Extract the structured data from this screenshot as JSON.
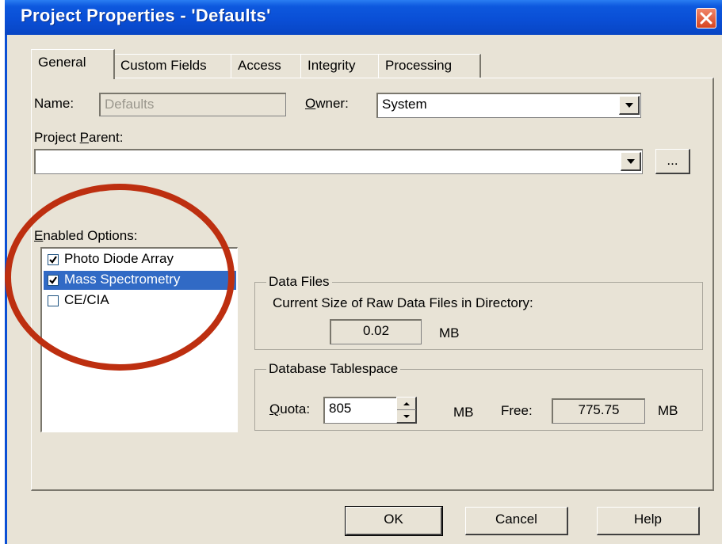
{
  "window": {
    "title": "Project Properties - 'Defaults'"
  },
  "tabs": [
    {
      "label": "General"
    },
    {
      "label": "Custom Fields"
    },
    {
      "label": "Access"
    },
    {
      "label": "Integrity"
    },
    {
      "label": "Processing"
    }
  ],
  "general": {
    "name_label": "Name:",
    "name_value": "Defaults",
    "owner_label_first": "O",
    "owner_label_rest": "wner:",
    "owner_value": "System",
    "parent_label_pre": "Project ",
    "parent_label_u": "P",
    "parent_label_post": "arent:",
    "parent_value": "",
    "browse_label": "...",
    "enabled_label_u": "E",
    "enabled_label_rest": "nabled Options:",
    "options": [
      {
        "label": "Photo Diode Array",
        "checked": true,
        "selected": false
      },
      {
        "label": "Mass Spectrometry",
        "checked": true,
        "selected": true
      },
      {
        "label": "CE/CIA",
        "checked": false,
        "selected": false
      }
    ]
  },
  "data_files": {
    "title": "Data Files",
    "caption": "Current Size of Raw Data Files in Directory:",
    "size_value": "0.02",
    "size_unit": "MB"
  },
  "tablespace": {
    "title": "Database Tablespace",
    "quota_label_u": "Q",
    "quota_label_rest": "uota:",
    "quota_value": "805",
    "quota_unit": "MB",
    "free_label": "Free:",
    "free_value": "775.75",
    "free_unit": "MB"
  },
  "buttons": {
    "ok": "OK",
    "cancel": "Cancel",
    "help": "Help"
  },
  "annotation": {
    "circle_color": "#bd2f10"
  }
}
